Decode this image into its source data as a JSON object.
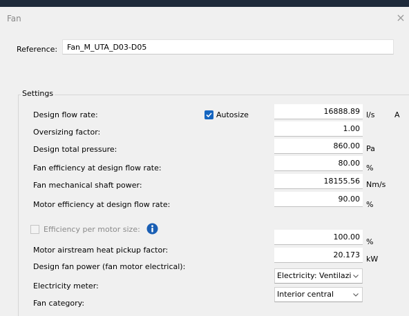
{
  "window": {
    "title": "Fan",
    "close_glyph": "×"
  },
  "reference": {
    "label": "Reference:",
    "value": "Fan_M_UTA_D03-D05"
  },
  "settings": {
    "title": "Settings",
    "autosize_label": "Autosize",
    "autosize_checked": true,
    "rows": [
      {
        "label": "Design flow rate:",
        "value": "16888.89",
        "unit": "l/s",
        "extra": "A"
      },
      {
        "label": "Oversizing factor:",
        "value": "1.00",
        "unit": ""
      },
      {
        "label": "Design total pressure:",
        "value": "860.00",
        "unit": "Pa"
      },
      {
        "label": "Fan efficiency at design flow rate:",
        "value": "80.00",
        "unit": "%"
      },
      {
        "label": "Fan mechanical shaft power:",
        "value": "18155.56",
        "unit": "Nm/s"
      },
      {
        "label": "Motor efficiency at design flow rate:",
        "value": "90.00",
        "unit": "%"
      },
      {
        "label": "Motor airstream heat pickup factor:",
        "value": "100.00",
        "unit": "%"
      },
      {
        "label": "Design fan power (fan motor electrical):",
        "value": "20.173",
        "unit": "kW"
      }
    ],
    "efficiency_per_motor": {
      "label": "Efficiency per motor size:",
      "checked": false,
      "icon": "info-icon"
    },
    "electricity_meter": {
      "label": "Electricity meter:",
      "selected": "Electricity: Ventilazi"
    },
    "fan_category": {
      "label": "Fan category:",
      "selected": "Interior central"
    }
  },
  "colors": {
    "accent": "#1565c0",
    "background": "#f0f0f0"
  }
}
